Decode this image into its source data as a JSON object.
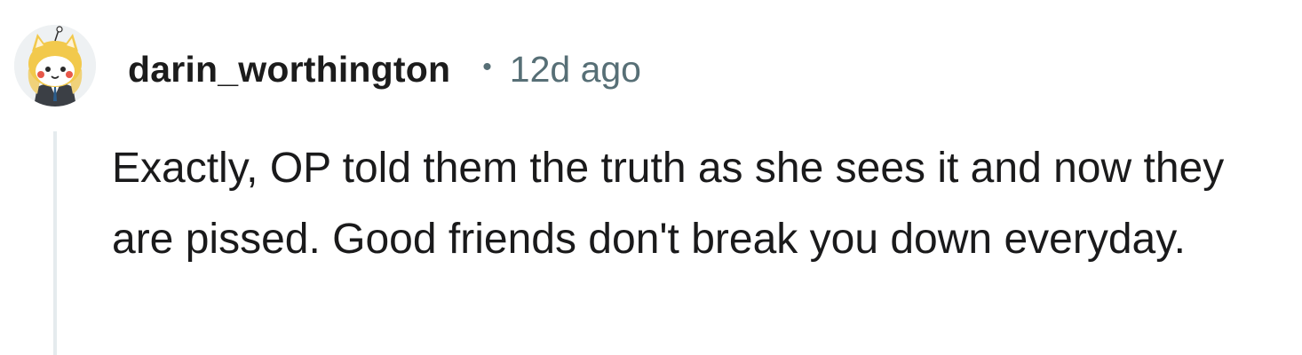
{
  "comment": {
    "username": "darin_worthington",
    "separator": "•",
    "timestamp": "12d ago",
    "body": "Exactly, OP told them the truth as she sees it and now they are pissed. Good friends don't break you down everyday.",
    "avatar_icon": "snoo-avatar-icon"
  },
  "colors": {
    "username": "#1c1c1c",
    "meta": "#576f76",
    "body": "#1a1a1b",
    "thread_line": "#e5ebee"
  }
}
